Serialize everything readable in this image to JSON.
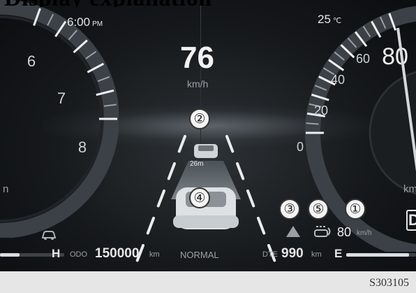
{
  "caption": {
    "text": "Display explanation"
  },
  "header": {
    "clock": "6:00",
    "clock_suffix": "PM",
    "temperature": "25",
    "temperature_unit": "℃"
  },
  "digital_speed": {
    "value": "76",
    "unit": "km/h"
  },
  "tachometer": {
    "labels": [
      "6",
      "7",
      "8"
    ],
    "side_text": "n"
  },
  "speedometer": {
    "labels": [
      "0",
      "20",
      "40",
      "60",
      "80"
    ],
    "side_text": "km"
  },
  "acc": {
    "set_speed": "80",
    "set_unit": "km/h",
    "distance_badge": "26m"
  },
  "callouts": [
    "①",
    "②",
    "③",
    "④",
    "⑤"
  ],
  "bottom": {
    "temp_hi": "H",
    "odo_label": "ODO",
    "odo_value": "150000",
    "odo_unit": "km",
    "drive_mode": "NORMAL",
    "dte_label": "DTE",
    "dte_value": "990",
    "dte_unit": "km",
    "fuel_empty": "E",
    "gear": "D"
  },
  "levels": {
    "coolant_temp_fraction": 0.3,
    "fuel_fraction": 0.9
  },
  "figure_code": "S303105",
  "icons": [
    "lane-car-icon",
    "warning-triangle-icon",
    "acc-radar-icon"
  ],
  "colors": {
    "background": "#121517",
    "text": "#e6e6e6",
    "accent_red": "#c0392b"
  }
}
